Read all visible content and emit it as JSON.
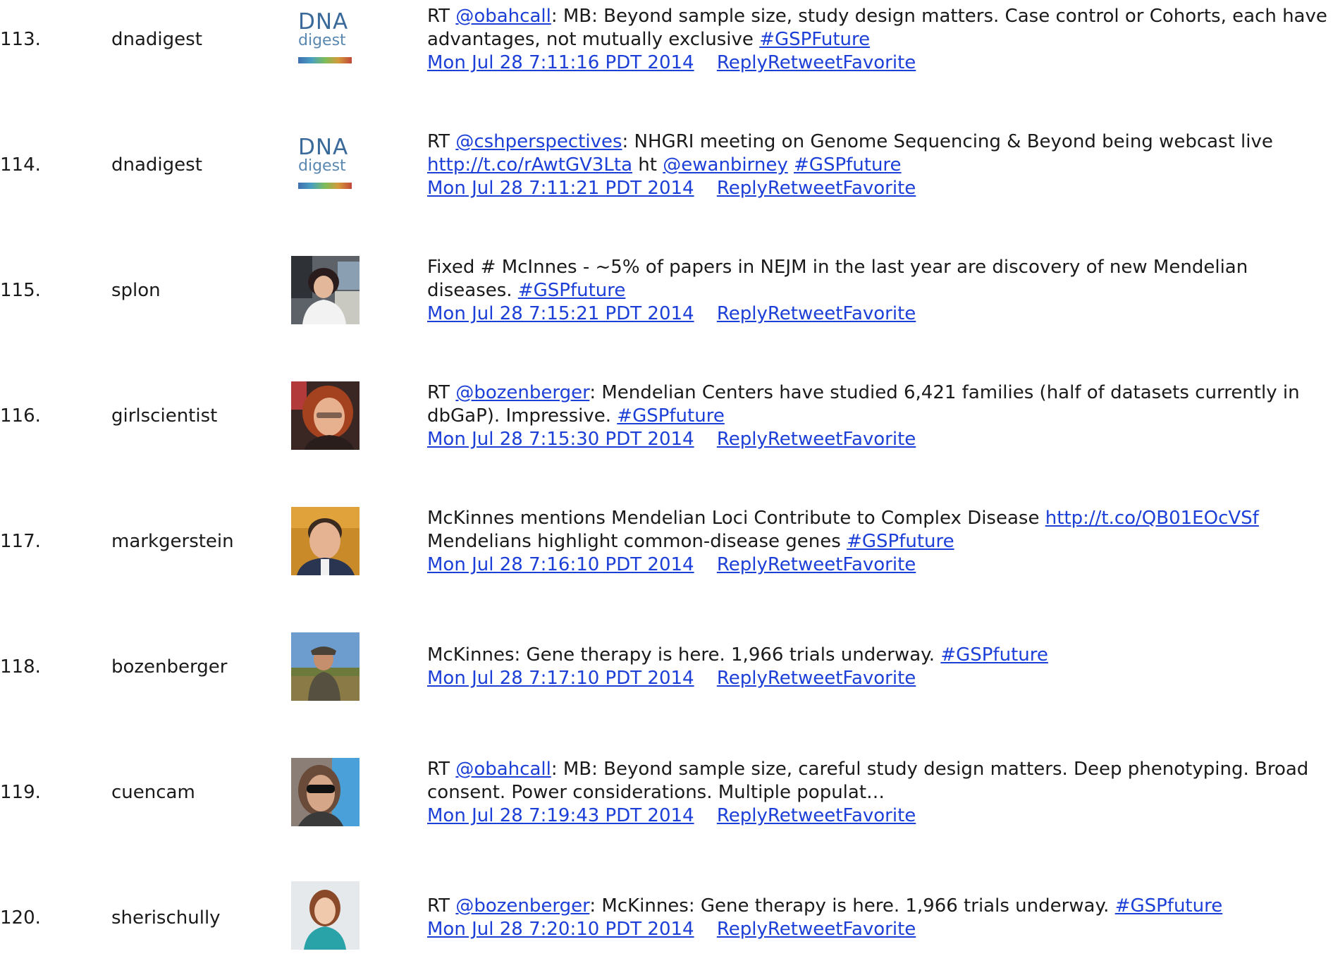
{
  "colors": {
    "link": "#1c3fd8",
    "text": "#1a1a1a",
    "background": "#ffffff"
  },
  "rows": [
    {
      "num": "113.",
      "user": "dnadigest",
      "avatar": "dna-digest-logo",
      "avatar_text_1": "DNA",
      "avatar_text_2": "digest",
      "tweet": {
        "prefix": "RT ",
        "mention": "@obahcall",
        "text": ": MB: Beyond sample size, study design matters. Case control or Cohorts, each have advantages, not mutually exclusive ",
        "hashtag": "#GSPFuture"
      },
      "timestamp": "Mon Jul 28 7:11:16 PDT 2014",
      "actions": "ReplyRetweetFavorite"
    },
    {
      "num": "114.",
      "user": "dnadigest",
      "avatar": "dna-digest-logo",
      "avatar_text_1": "DNA",
      "avatar_text_2": "digest",
      "tweet": {
        "prefix": "RT ",
        "mention": "@cshperspectives",
        "text": ": NHGRI meeting on Genome Sequencing & Beyond being webcast live ",
        "link": "http://t.co/rAwtGV3Lta",
        "text2": " ht ",
        "mention2": "@ewanbirney",
        "text3": " ",
        "hashtag": "#GSPfuture"
      },
      "timestamp": "Mon Jul 28 7:11:21 PDT 2014",
      "actions": "ReplyRetweetFavorite"
    },
    {
      "num": "115.",
      "user": "splon",
      "avatar": "profile-photo",
      "tweet": {
        "text": "Fixed # McInnes - ~5% of papers in NEJM in the last year are discovery of new Mendelian diseases. ",
        "hashtag": "#GSPfuture"
      },
      "timestamp": "Mon Jul 28 7:15:21 PDT 2014",
      "actions": "ReplyRetweetFavorite"
    },
    {
      "num": "116.",
      "user": "girlscientist",
      "avatar": "profile-photo",
      "tweet": {
        "prefix": "RT ",
        "mention": "@bozenberger",
        "text": ": Mendelian Centers have studied 6,421 families (half of datasets currently in dbGaP). Impressive. ",
        "hashtag": "#GSPfuture"
      },
      "timestamp": "Mon Jul 28 7:15:30 PDT 2014",
      "actions": "ReplyRetweetFavorite"
    },
    {
      "num": "117.",
      "user": "markgerstein",
      "avatar": "profile-photo",
      "tweet": {
        "text": "McKinnes mentions Mendelian Loci Contribute to Complex Disease ",
        "link": "http://t.co/QB01EOcVSf",
        "text2": " Mendelians highlight common-disease genes ",
        "hashtag": "#GSPfuture"
      },
      "timestamp": "Mon Jul 28 7:16:10 PDT 2014",
      "actions": "ReplyRetweetFavorite"
    },
    {
      "num": "118.",
      "user": "bozenberger",
      "avatar": "profile-photo",
      "tweet": {
        "text": "McKinnes: Gene therapy is here. 1,966 trials underway. ",
        "hashtag": "#GSPfuture"
      },
      "timestamp": "Mon Jul 28 7:17:10 PDT 2014",
      "actions": "ReplyRetweetFavorite"
    },
    {
      "num": "119.",
      "user": "cuencam",
      "avatar": "profile-photo",
      "tweet": {
        "prefix": "RT ",
        "mention": "@obahcall",
        "text": ": MB: Beyond sample size, careful study design matters. Deep phenotyping. Broad consent. Power considerations. Multiple populat…"
      },
      "timestamp": "Mon Jul 28 7:19:43 PDT 2014",
      "actions": "ReplyRetweetFavorite"
    },
    {
      "num": "120.",
      "user": "sherischully",
      "avatar": "profile-photo",
      "tweet": {
        "prefix": "RT ",
        "mention": "@bozenberger",
        "text": ": McKinnes: Gene therapy is here. 1,966 trials underway. ",
        "hashtag": "#GSPfuture"
      },
      "timestamp": "Mon Jul 28 7:20:10 PDT 2014",
      "actions": "ReplyRetweetFavorite"
    }
  ]
}
